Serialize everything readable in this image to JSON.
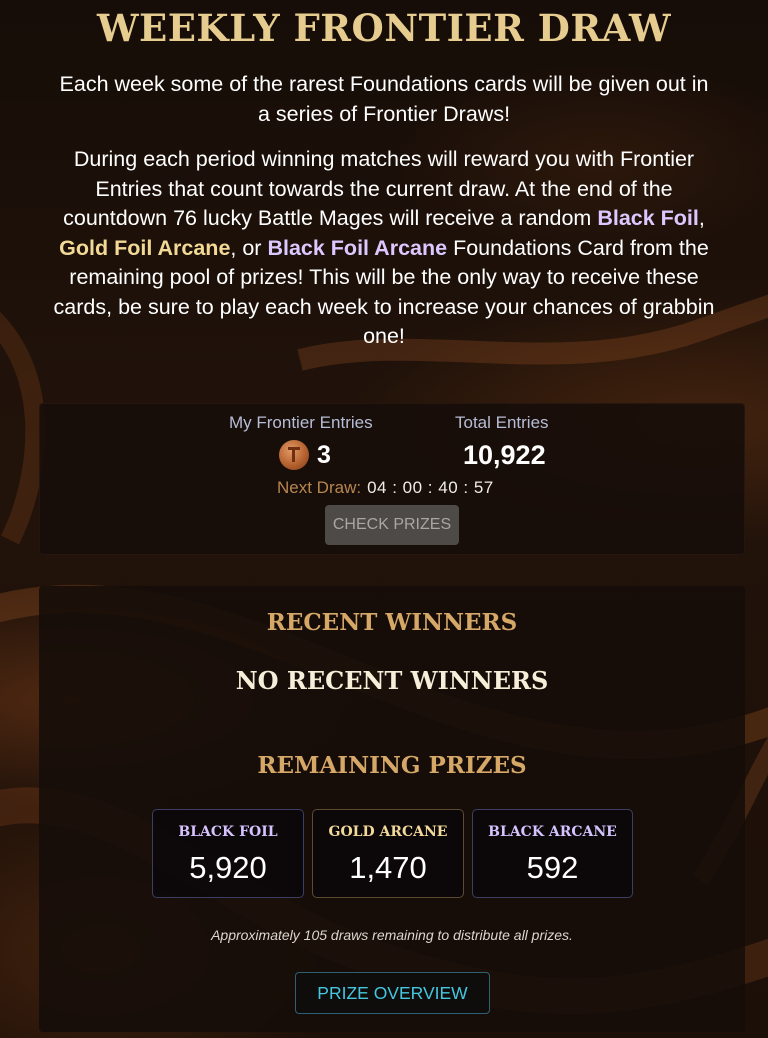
{
  "page": {
    "title": "WEEKLY FRONTIER DRAW",
    "intro_line1": "Each week some of the rarest Foundations cards will be given out in",
    "intro_line2": "a series of Frontier Draws!",
    "desc_line1": "During each period winning matches will reward you with Frontier",
    "desc_line2": "Entries that count towards the current draw. At the end of the",
    "desc_line3_a": "countdown 76 lucky Battle Mages will receive a random ",
    "desc_line3_b": "Black Foil",
    "desc_line3_c": ",",
    "desc_line4_a": "Gold Foil Arcane",
    "desc_line4_b": ", or ",
    "desc_line4_c": "Black Foil Arcane",
    "desc_line4_d": " Foundations Card from the",
    "desc_line5": "remaining pool of prizes! This will be the only way to receive these",
    "desc_line6": "cards, be sure to play each week to increase your chances of grabbin",
    "desc_line7": "one!"
  },
  "entries": {
    "my_label": "My Frontier Entries",
    "my_value": "3",
    "total_label": "Total Entries",
    "total_value": "10,922",
    "next_draw_label": "Next Draw:",
    "next_draw_time": "04 : 00 : 40 : 57",
    "check_prizes_label": "CHECK PRIZES",
    "coin_icon": "frontier-entry-coin-icon"
  },
  "winners": {
    "recent_heading": "RECENT WINNERS",
    "no_winners_text": "NO RECENT WINNERS",
    "remaining_heading": "REMAINING PRIZES",
    "prizes": [
      {
        "label": "BLACK FOIL",
        "value": "5,920"
      },
      {
        "label": "GOLD ARCANE",
        "value": "1,470"
      },
      {
        "label": "BLACK ARCANE",
        "value": "592"
      }
    ],
    "note": "Approximately 105 draws remaining to distribute all prizes.",
    "overview_label": "PRIZE OVERVIEW"
  },
  "colors": {
    "title_gold": "#e6cc8f",
    "highlight_purple": "#dcc8ff",
    "highlight_gold": "#f2da96",
    "heading_bronze": "#d6a868",
    "overview_cyan": "#45c7e0"
  }
}
